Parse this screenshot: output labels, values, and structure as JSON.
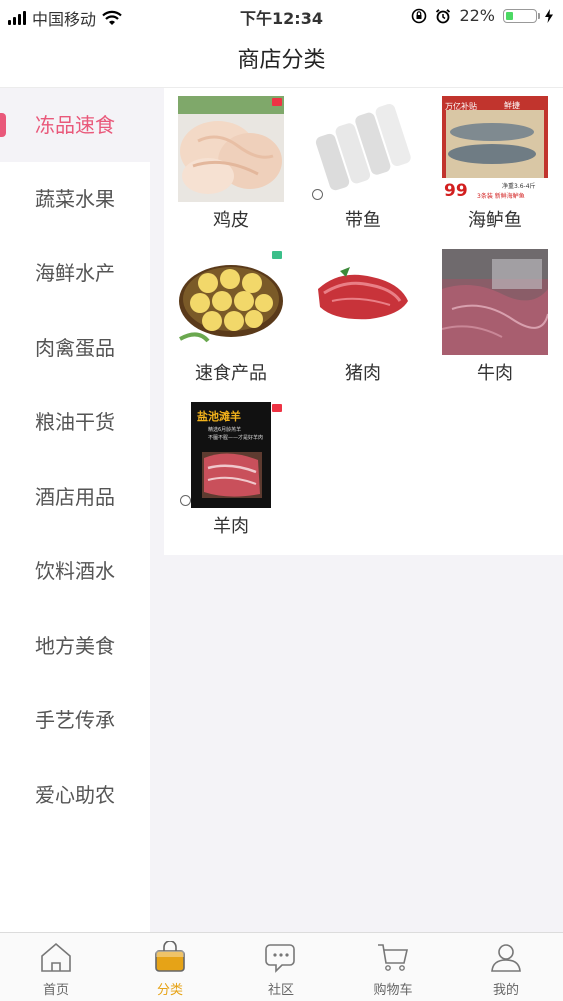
{
  "status": {
    "carrier": "中国移动",
    "time": "下午12:34",
    "battery": "22%"
  },
  "header": {
    "title": "商店分类"
  },
  "sidebar": {
    "items": [
      {
        "label": "冻品速食",
        "active": true
      },
      {
        "label": "蔬菜水果"
      },
      {
        "label": "海鲜水产"
      },
      {
        "label": "肉禽蛋品"
      },
      {
        "label": "粮油干货"
      },
      {
        "label": "酒店用品"
      },
      {
        "label": "饮料酒水"
      },
      {
        "label": "地方美食"
      },
      {
        "label": "手艺传承"
      },
      {
        "label": "爱心助农"
      }
    ]
  },
  "products": [
    {
      "name": "鸡皮"
    },
    {
      "name": "带鱼"
    },
    {
      "name": "海鲈鱼",
      "badge_top": "鲜捷",
      "badge_side": "万亿补贴",
      "price": "99",
      "spec": "净重3.6-4斤",
      "tag": "3条装 新鲜海鲈鱼"
    },
    {
      "name": "速食产品"
    },
    {
      "name": "猪肉"
    },
    {
      "name": "牛肉"
    },
    {
      "name": "羊肉",
      "headline": "盐池滩羊",
      "sub1": "精选6月龄羔羊",
      "sub2": "不膻不腥——才是好羊肉"
    }
  ],
  "tabbar": {
    "items": [
      {
        "label": "首页",
        "icon": "home-icon"
      },
      {
        "label": "分类",
        "icon": "category-bag-icon",
        "active": true
      },
      {
        "label": "社区",
        "icon": "community-chat-icon"
      },
      {
        "label": "购物车",
        "icon": "cart-icon"
      },
      {
        "label": "我的",
        "icon": "profile-icon"
      }
    ]
  },
  "colors": {
    "accent": "#e9587a",
    "tab_active": "#e6a317"
  }
}
